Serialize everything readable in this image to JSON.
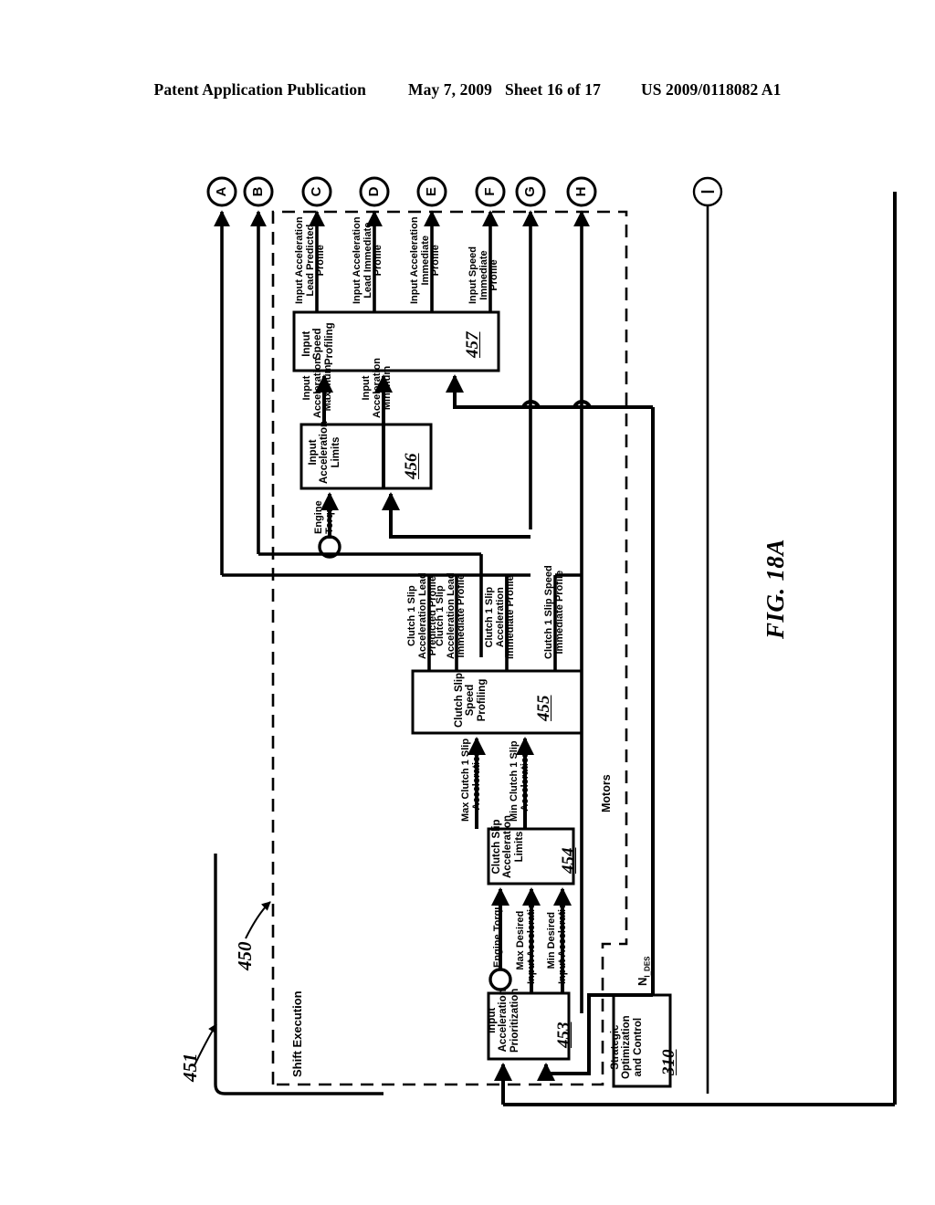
{
  "header": {
    "publication": "Patent Application Publication",
    "date": "May 7, 2009",
    "sheet": "Sheet 16 of 17",
    "patent_number": "US 2009/0118082 A1"
  },
  "figure": {
    "caption": "FIG. 18A",
    "group_label": "Shift Execution",
    "ref_450": "450",
    "ref_451": "451",
    "motors_label": "Motors"
  },
  "nodes": [
    {
      "id": "A",
      "label": "A"
    },
    {
      "id": "B",
      "label": "B"
    },
    {
      "id": "C",
      "label": "C"
    },
    {
      "id": "D",
      "label": "D"
    },
    {
      "id": "E",
      "label": "E"
    },
    {
      "id": "F",
      "label": "F"
    },
    {
      "id": "G",
      "label": "G"
    },
    {
      "id": "H",
      "label": "H"
    },
    {
      "id": "I",
      "label": "I"
    }
  ],
  "blocks": [
    {
      "id": "453",
      "title": "Input\nAcceleration\nPrioritization",
      "number": "453"
    },
    {
      "id": "454",
      "title": "Clutch Slip\nAcceleration\nLimits",
      "number": "454"
    },
    {
      "id": "455",
      "title": "Clutch Slip\nSpeed\nProfiling",
      "number": "455"
    },
    {
      "id": "456",
      "title": "Input\nAcceleration\nLimits",
      "number": "456"
    },
    {
      "id": "457",
      "title": "Input\nSpeed\nProfiling",
      "number": "457"
    },
    {
      "id": "310",
      "title": "Strategic\nOptimization\nand Control",
      "number": "310"
    }
  ],
  "signals": {
    "input_accel_lead_predicted": "Input Acceleration\nLead Predicted\nProfile",
    "input_accel_lead_immediate": "Input Acceleration\nLead Immediate\nProfile",
    "input_accel_immediate": "Input Acceleration\nImmediate\nProfile",
    "input_speed_immediate": "Input Speed\nImmediate\nProfile",
    "input_accel_max": "Input\nAcceleration\nMaximum",
    "input_accel_min": "Input\nAcceleration\nMinimum",
    "engine_torque_456": "Engine\nTorque",
    "clutch1_slip_accel_lead_predicted": "Clutch 1 Slip\nAcceleration Lead\nPredicted Profile",
    "clutch1_slip_accel_lead_immediate": "Clutch 1 Slip\nAcceleration Lead\nImmediate Profile",
    "clutch1_slip_accel_immediate": "Clutch 1 Slip\nAcceleration\nImmediate Profile",
    "clutch1_slip_speed_immediate": "Clutch 1 Slip Speed\nImmediate Profile",
    "max_clutch1_slip_accel": "Max Clutch 1 Slip\nAcceleration",
    "min_clutch1_slip_accel": "Min Clutch 1 Slip\nAcceleration",
    "engine_torque_454": "Engine Torque",
    "max_desired_input_accel": "Max Desired\nInput Acceleration",
    "min_desired_input_accel": "Min Desired\nInput Acceleration",
    "ni_des": "N I_DES"
  },
  "colors": {
    "ink": "#000000",
    "paper": "#ffffff"
  }
}
